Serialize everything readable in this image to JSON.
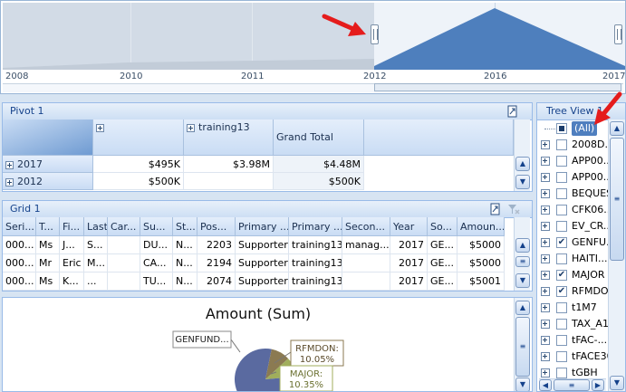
{
  "range": {
    "years": [
      "2008",
      "2010",
      "2011",
      "2012",
      "2016",
      "2017"
    ]
  },
  "pivot": {
    "title": "Pivot 1",
    "col_headers": [
      "",
      "training13",
      "Grand Total"
    ],
    "rows": [
      {
        "label": "2017",
        "values": [
          "$495K",
          "$3.98M",
          "$4.48M"
        ]
      },
      {
        "label": "2012",
        "values": [
          "$500K",
          "",
          "$500K"
        ]
      }
    ]
  },
  "grid": {
    "title": "Grid 1",
    "columns": [
      "Seri...",
      "T...",
      "Fi...",
      "Last",
      "Car...",
      "Su...",
      "St...",
      "Pos...",
      "Primary ...",
      "Primary ...",
      "Secon...",
      "Year",
      "So...",
      "Amoun..."
    ],
    "rows": [
      [
        "000...",
        "Ms",
        "J...",
        "S...",
        "",
        "DU...",
        "N...",
        "2203",
        "Supporter",
        "training13",
        "manag...",
        "2017",
        "GE...",
        "$5000"
      ],
      [
        "000...",
        "Mr",
        "Eric",
        "M...",
        "",
        "CA...",
        "N...",
        "2194",
        "Supporter",
        "training13",
        "",
        "2017",
        "GE...",
        "$5000"
      ],
      [
        "000...",
        "Ms",
        "K...",
        "...",
        "",
        "TU...",
        "N...",
        "2074",
        "Supporter",
        "training13",
        "",
        "2017",
        "GE...",
        "$5001"
      ]
    ]
  },
  "chart": {
    "title": "Amount (Sum)"
  },
  "chart_data": {
    "type": "pie",
    "title": "Amount (Sum)",
    "slices": [
      {
        "label": "GENFUND...",
        "percent": null,
        "color": "#5a6aa0"
      },
      {
        "label": "RFMDON: 10.05%",
        "percent": 10.05,
        "color": "#8b7a52"
      },
      {
        "label": "MAJOR: 10.35%",
        "percent": 10.35,
        "color": "#a0ae5c"
      }
    ]
  },
  "tree": {
    "title": "Tree View 1",
    "items": [
      {
        "label": "(All)",
        "check": "partial"
      },
      {
        "label": "2008D...",
        "check": "none"
      },
      {
        "label": "APP00...",
        "check": "none"
      },
      {
        "label": "APP00...",
        "check": "none"
      },
      {
        "label": "BEQUES",
        "check": "none"
      },
      {
        "label": "CFK06...",
        "check": "none"
      },
      {
        "label": "EV_CR...",
        "check": "none"
      },
      {
        "label": "GENFU...",
        "check": "checked"
      },
      {
        "label": "HAITI...",
        "check": "none"
      },
      {
        "label": "MAJOR",
        "check": "checked"
      },
      {
        "label": "RFMDON",
        "check": "checked"
      },
      {
        "label": "t1M7",
        "check": "none"
      },
      {
        "label": "TAX_A1",
        "check": "none"
      },
      {
        "label": "tFAC-...",
        "check": "none"
      },
      {
        "label": "tFACE30",
        "check": "none"
      },
      {
        "label": "tGBH",
        "check": "none"
      }
    ]
  },
  "colors": {
    "accent": "#4f7fbf",
    "header": "#15428b",
    "arrow": "#e51c1c"
  }
}
